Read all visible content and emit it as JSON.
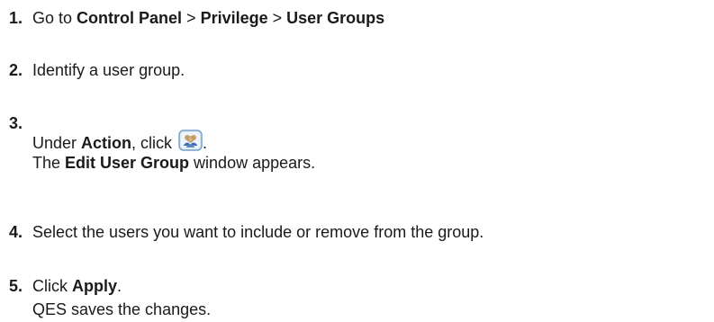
{
  "steps": [
    {
      "number": "1.",
      "text": {
        "prefix": "Go to ",
        "path1": "Control Panel",
        "sep1": " > ",
        "path2": "Privilege",
        "sep2": " > ",
        "path3": "User Groups"
      }
    },
    {
      "number": "2.",
      "text": "Identify a user group."
    },
    {
      "number": "3.",
      "line1": {
        "prefix": "Under ",
        "bold": "Action",
        "suffix": ", click ",
        "icon": "edit-user-group-icon",
        "end": "."
      },
      "line2": {
        "prefix": "The ",
        "bold": "Edit User Group",
        "suffix": " window appears."
      }
    },
    {
      "number": "4.",
      "text": "Select the users you want to include or remove from the group."
    },
    {
      "number": "5.",
      "line1": {
        "prefix": "Click ",
        "bold": "Apply",
        "suffix": "."
      },
      "line2": "QES saves the changes."
    }
  ],
  "colors": {
    "text": "#1a1a1a",
    "icon_border": "#7aa0c8",
    "icon_fill": "#dde9f5",
    "icon_figure": "#c9a06a"
  }
}
